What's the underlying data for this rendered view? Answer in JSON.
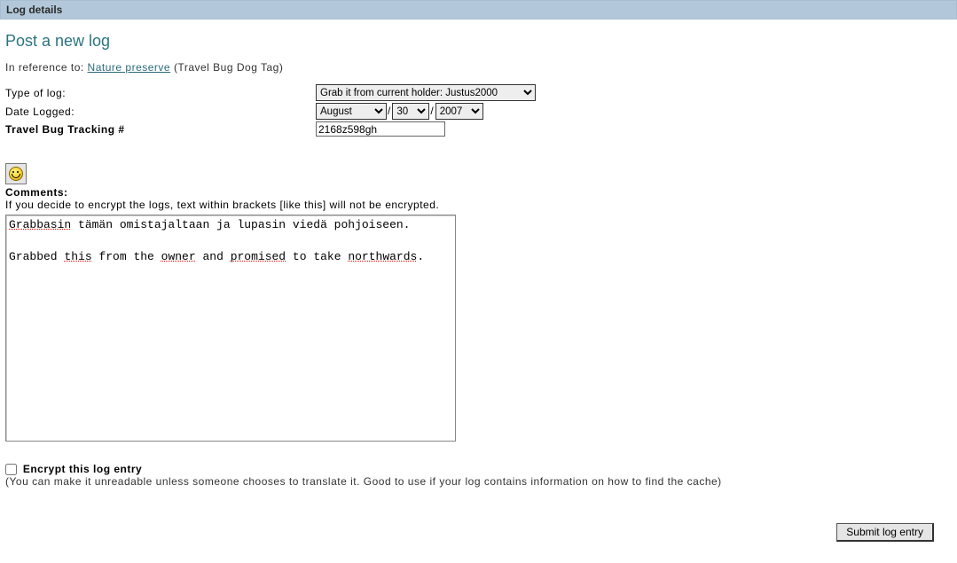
{
  "header": {
    "title": "Log details"
  },
  "page": {
    "title": "Post a new log"
  },
  "reference": {
    "prefix": "In reference to: ",
    "link_text": "Nature preserve",
    "suffix": " (Travel Bug Dog Tag)"
  },
  "form": {
    "type_label": "Type of log:",
    "type_selected": "Grab it from current holder: Justus2000",
    "date_label": "Date Logged:",
    "month_selected": "August",
    "day_selected": "30",
    "year_selected": "2007",
    "tracking_label": "Travel Bug Tracking #",
    "tracking_value": "2168z598gh"
  },
  "comments": {
    "label": "Comments:",
    "hint": "If you decide to encrypt the logs, text within brackets [like this] will not be encrypted.",
    "line1_w1": "Grabbasin",
    "line1_rest": " tämän omistajaltaan ja lupasin viedä pohjoiseen.",
    "line2_pre": "Grabbed ",
    "line2_w_this": "this",
    "line2_mid1": " from the ",
    "line2_w_owner": "owner",
    "line2_mid2": " and ",
    "line2_w_promised": "promised",
    "line2_mid3": " to take ",
    "line2_w_north": "northwards",
    "line2_end": "."
  },
  "encrypt": {
    "checkbox_label": "Encrypt this log entry",
    "desc": "(You can make it unreadable unless someone chooses to translate it. Good to use if your log contains information on how to find the cache)"
  },
  "submit": {
    "label": "Submit log entry"
  }
}
